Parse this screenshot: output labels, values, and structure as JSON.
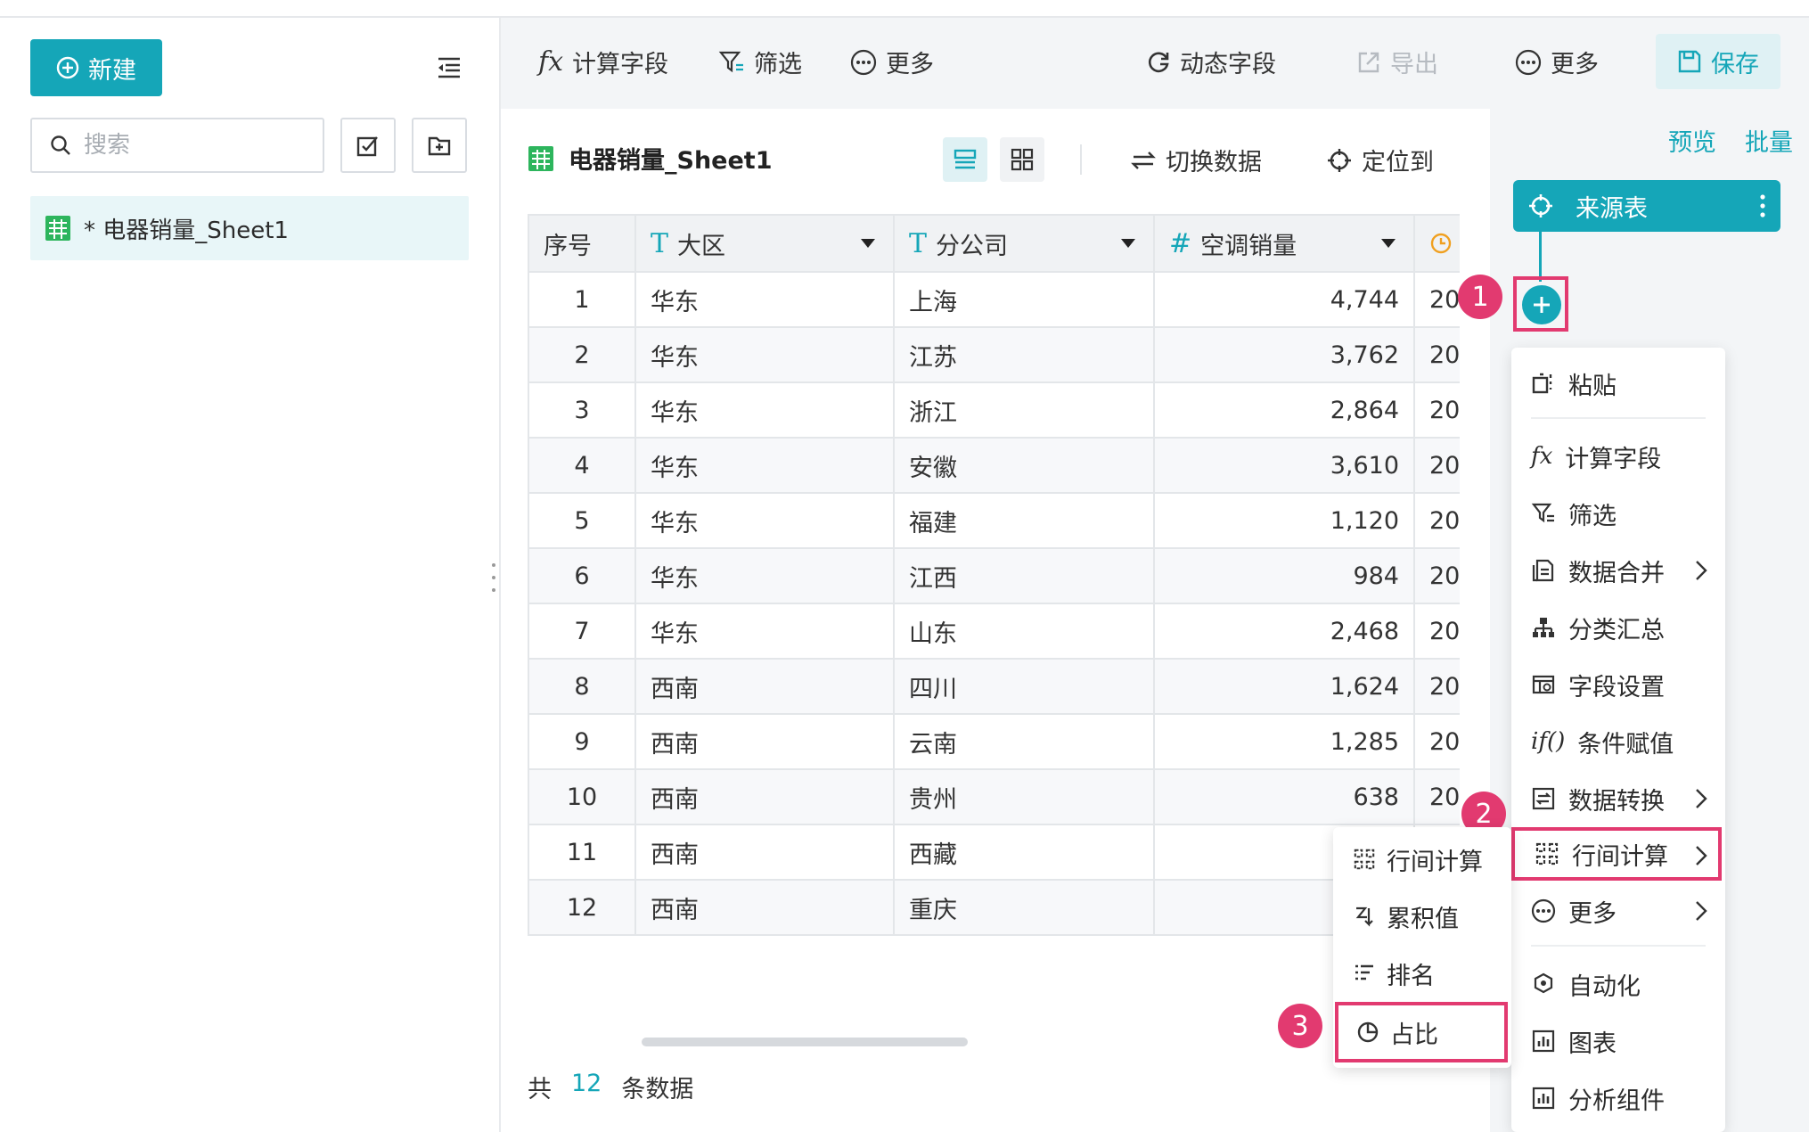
{
  "sidebar": {
    "new_label": "新建",
    "search_placeholder": "搜索",
    "tree_item": "* 电器销量_Sheet1"
  },
  "toolbar": {
    "calc_field": "计算字段",
    "filter": "筛选",
    "more": "更多",
    "dynamic_field": "动态字段",
    "export": "导出",
    "more2": "更多",
    "save": "保存"
  },
  "sheet": {
    "title": "电器销量_Sheet1",
    "switch_data": "切换数据",
    "locate": "定位到"
  },
  "table": {
    "columns": [
      "序号",
      "大区",
      "分公司",
      "空调销量"
    ],
    "rows": [
      [
        "1",
        "华东",
        "上海",
        "4,744",
        "20"
      ],
      [
        "2",
        "华东",
        "江苏",
        "3,762",
        "20"
      ],
      [
        "3",
        "华东",
        "浙江",
        "2,864",
        "20"
      ],
      [
        "4",
        "华东",
        "安徽",
        "3,610",
        "20"
      ],
      [
        "5",
        "华东",
        "福建",
        "1,120",
        "20"
      ],
      [
        "6",
        "华东",
        "江西",
        "984",
        "20"
      ],
      [
        "7",
        "华东",
        "山东",
        "2,468",
        "20"
      ],
      [
        "8",
        "西南",
        "四川",
        "1,624",
        "20"
      ],
      [
        "9",
        "西南",
        "云南",
        "1,285",
        "20"
      ],
      [
        "10",
        "西南",
        "贵州",
        "638",
        "20"
      ],
      [
        "11",
        "西南",
        "西藏",
        "",
        ""
      ],
      [
        "12",
        "西南",
        "重庆",
        "",
        ""
      ]
    ]
  },
  "footer": {
    "prefix": "共",
    "count": "12",
    "suffix": "条数据"
  },
  "panel": {
    "preview": "预览",
    "batch": "批量",
    "source_node": "来源表",
    "badges": [
      "1",
      "2",
      "3"
    ]
  },
  "menu": {
    "items": [
      "粘贴",
      "计算字段",
      "筛选",
      "数据合并",
      "分类汇总",
      "字段设置",
      "条件赋值",
      "数据转换",
      "行间计算",
      "更多",
      "自动化",
      "图表",
      "分析组件"
    ]
  },
  "submenu": {
    "items": [
      "行间计算",
      "累积值",
      "排名",
      "占比"
    ]
  },
  "colors": {
    "accent": "#15a6b8",
    "highlight": "#e23a70"
  }
}
